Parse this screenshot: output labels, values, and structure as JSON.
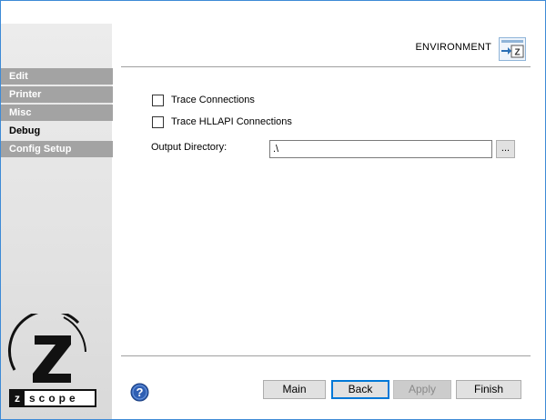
{
  "sidebar": {
    "items": [
      {
        "label": "Edit",
        "active": false
      },
      {
        "label": "Printer",
        "active": false
      },
      {
        "label": "Misc",
        "active": false
      },
      {
        "label": "Debug",
        "active": true
      },
      {
        "label": "Config Setup",
        "active": false
      }
    ],
    "logo_text": "zscope"
  },
  "header": {
    "title": "ENVIRONMENT",
    "icon": "environment-icon"
  },
  "form": {
    "trace_connections": {
      "label": "Trace Connections",
      "checked": false
    },
    "trace_hllapi": {
      "label": "Trace HLLAPI Connections",
      "checked": false
    },
    "output_directory": {
      "label": "Output Directory:",
      "value": ".\\"
    },
    "browse_label": "..."
  },
  "footer": {
    "help_icon": "question-icon",
    "buttons": {
      "main": "Main",
      "back": "Back",
      "apply": "Apply",
      "finish": "Finish"
    },
    "apply_disabled": true
  },
  "colors": {
    "nav_inactive_bg": "#a3a3a3",
    "focus_blue": "#0078d7",
    "window_border": "#3d8ad6"
  }
}
